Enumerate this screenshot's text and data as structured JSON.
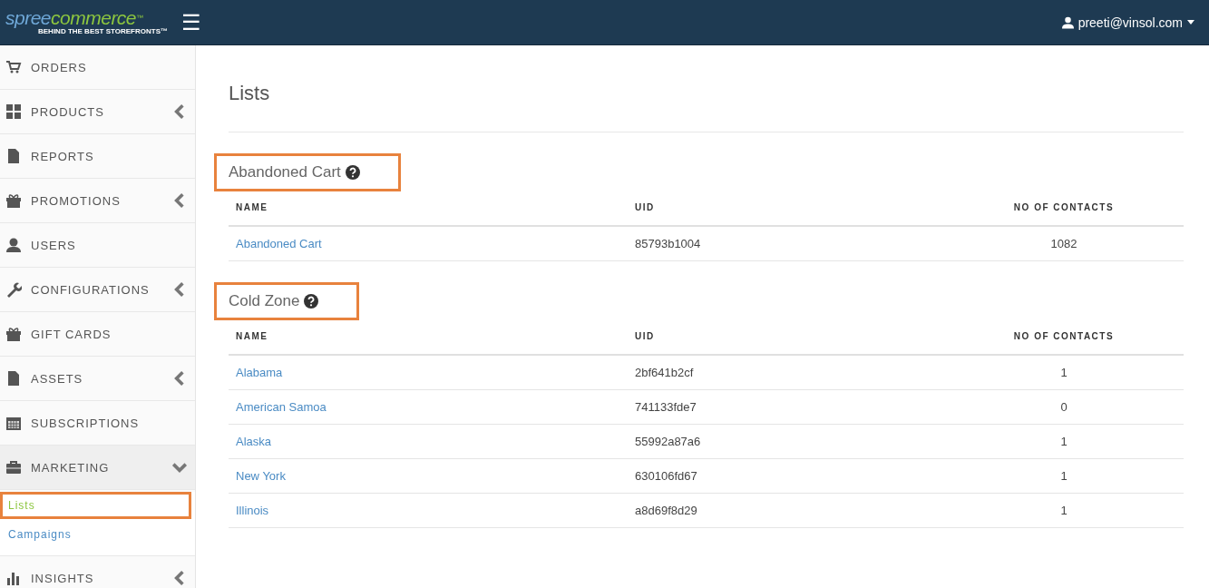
{
  "header": {
    "logo": {
      "brand_first": "spree",
      "brand_second": "commerce",
      "trademark": "™",
      "tagline": "BEHIND THE BEST STOREFRONTS™"
    },
    "menu_toggle": "☰",
    "user": {
      "email": "preeti@vinsol.com"
    }
  },
  "sidebar": {
    "items": [
      {
        "label": "ORDERS"
      },
      {
        "label": "PRODUCTS",
        "expanded": false
      },
      {
        "label": "REPORTS"
      },
      {
        "label": "PROMOTIONS",
        "expanded": false
      },
      {
        "label": "USERS"
      },
      {
        "label": "CONFIGURATIONS",
        "expanded": false
      },
      {
        "label": "GIFT CARDS"
      },
      {
        "label": "ASSETS",
        "expanded": false
      },
      {
        "label": "SUBSCRIPTIONS"
      },
      {
        "label": "MARKETING",
        "expanded": true,
        "children": [
          {
            "label": "Lists",
            "selected": true,
            "highlighted": true
          },
          {
            "label": "Campaigns",
            "selected": false,
            "highlighted": false
          }
        ]
      },
      {
        "label": "INSIGHTS",
        "expanded": false
      }
    ]
  },
  "main": {
    "title": "Lists",
    "sections": [
      {
        "heading": "Abandoned Cart",
        "highlighted": true,
        "columns": [
          "NAME",
          "UID",
          "NO OF CONTACTS"
        ],
        "rows": [
          {
            "name": "Abandoned Cart",
            "uid": "85793b1004",
            "contacts": "1082"
          }
        ]
      },
      {
        "heading": "Cold Zone",
        "highlighted": true,
        "columns": [
          "NAME",
          "UID",
          "NO OF CONTACTS"
        ],
        "rows": [
          {
            "name": "Alabama",
            "uid": "2bf641b2cf",
            "contacts": "1"
          },
          {
            "name": "American Samoa",
            "uid": "741133fde7",
            "contacts": "0"
          },
          {
            "name": "Alaska",
            "uid": "55992a87a6",
            "contacts": "1"
          },
          {
            "name": "New York",
            "uid": "630106fd67",
            "contacts": "1"
          },
          {
            "name": "Illinois",
            "uid": "a8d69f8d29",
            "contacts": "1"
          }
        ]
      }
    ]
  }
}
